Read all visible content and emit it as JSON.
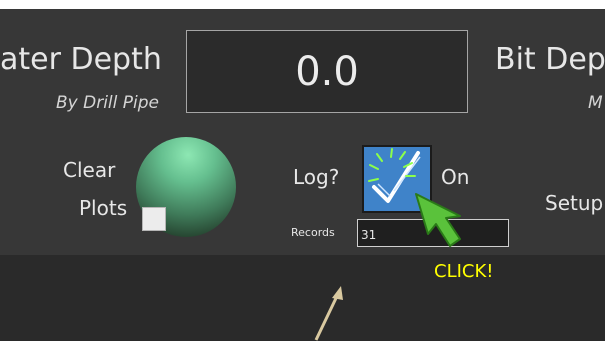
{
  "water_depth": {
    "title": "ater Depth",
    "subtitle": "By Drill Pipe",
    "value": "0.0"
  },
  "bit_depth": {
    "title": "Bit Dep",
    "subtitle": "M"
  },
  "clear_plots": {
    "line1": "Clear",
    "line2": "Plots"
  },
  "log": {
    "label": "Log?",
    "state_label": "On",
    "checked": true
  },
  "records": {
    "label": "Records",
    "value": "31"
  },
  "setup": {
    "label": "Setup"
  },
  "annotation": {
    "text": "CLICK!",
    "color": "#ffff00"
  },
  "colors": {
    "panel": "#373737",
    "lower_panel": "#2a2a2a",
    "toggle_blue": "#3f83c9",
    "cursor_green": "#5ac23b"
  }
}
